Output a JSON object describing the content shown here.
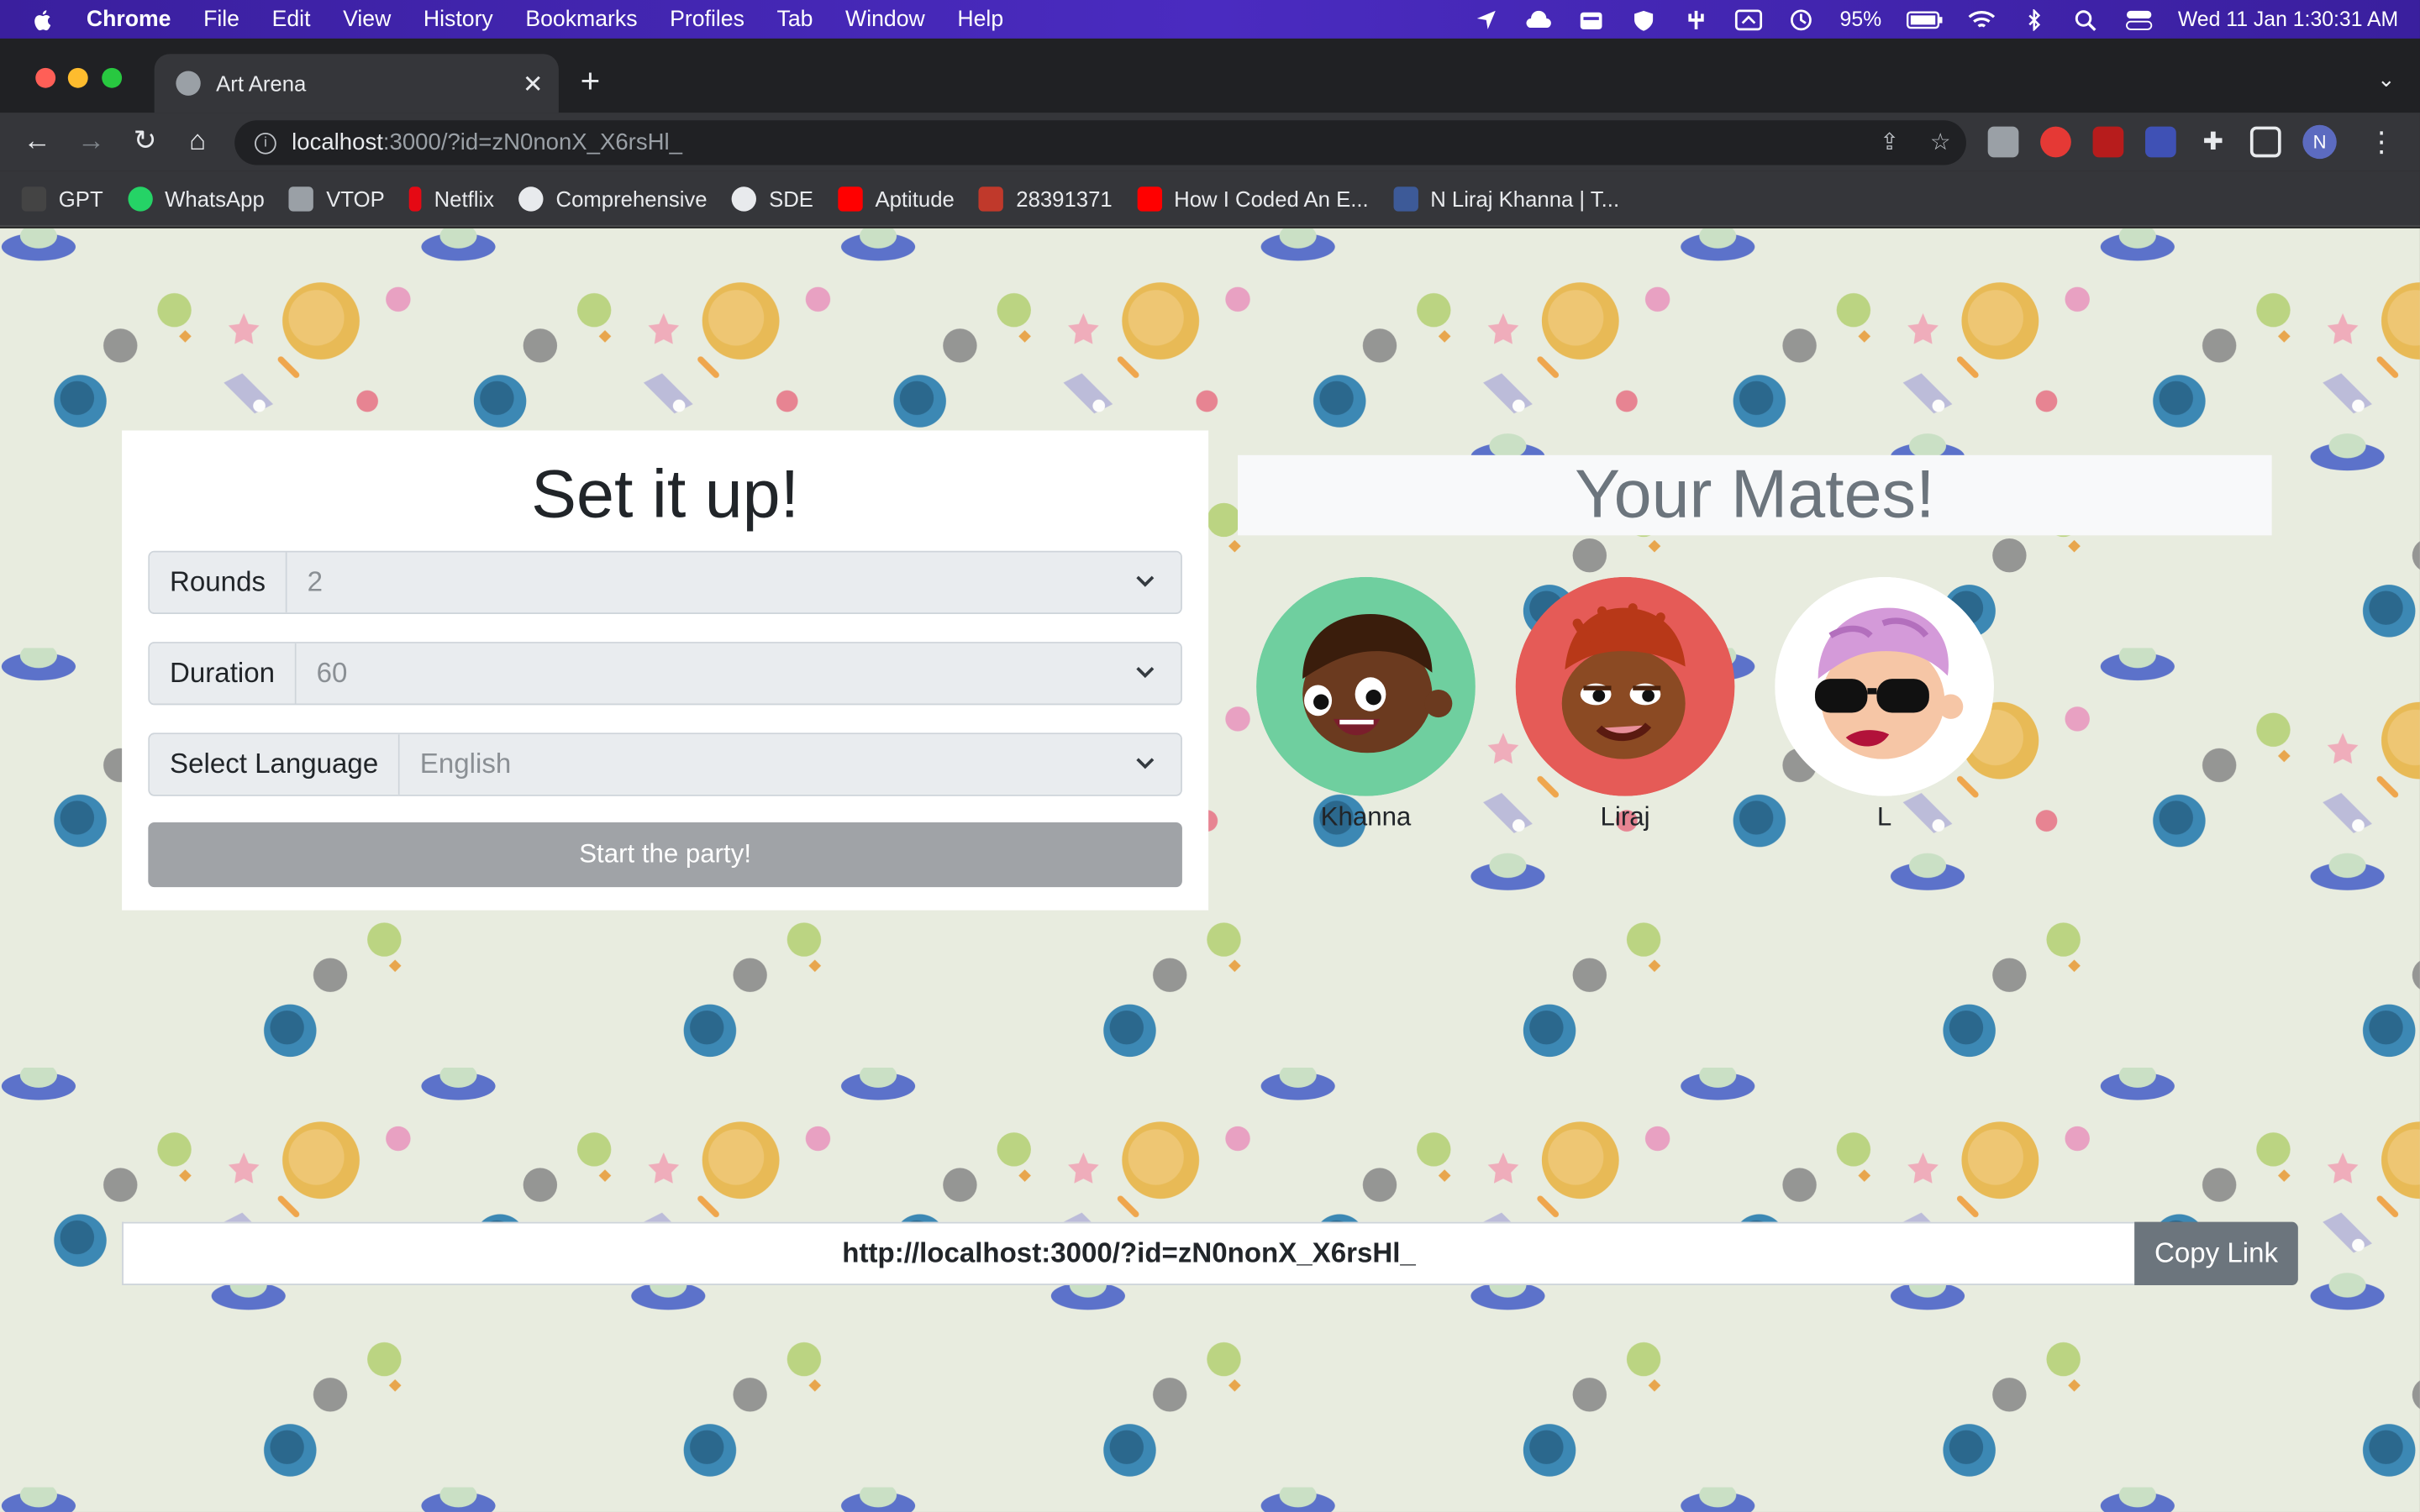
{
  "menubar": {
    "app": "Chrome",
    "items": [
      "File",
      "Edit",
      "View",
      "History",
      "Bookmarks",
      "Profiles",
      "Tab",
      "Window",
      "Help"
    ],
    "battery": "95%",
    "datetime": "Wed 11 Jan  1:30:31 AM"
  },
  "browser": {
    "tab_title": "Art Arena",
    "url_host": "localhost",
    "url_path": ":3000/?id=zN0nonX_X6rsHl_",
    "profile_initial": "N",
    "bookmarks": [
      {
        "label": "GPT",
        "color": "#444444"
      },
      {
        "label": "WhatsApp",
        "color": "#25d366"
      },
      {
        "label": "VTOP",
        "color": "#9aa0a6"
      },
      {
        "label": "Netflix",
        "color": "#e50914"
      },
      {
        "label": "Comprehensive",
        "color": "#e8eaed"
      },
      {
        "label": "SDE",
        "color": "#e8eaed"
      },
      {
        "label": "Aptitude",
        "color": "#ff0000"
      },
      {
        "label": "28391371",
        "color": "#c0392b"
      },
      {
        "label": "How I Coded An E...",
        "color": "#ff0000"
      },
      {
        "label": "N Liraj Khanna | T...",
        "color": "#3d5a98"
      }
    ]
  },
  "setup": {
    "title": "Set it up!",
    "rounds_label": "Rounds",
    "rounds_value": "2",
    "duration_label": "Duration",
    "duration_value": "60",
    "language_label": "Select Language",
    "language_value": "English",
    "start_button": "Start the party!"
  },
  "mates": {
    "title": "Your Mates!",
    "players": [
      {
        "name": "Khanna",
        "bg": "#6fcf9f"
      },
      {
        "name": "Liraj",
        "bg": "#e55b57"
      },
      {
        "name": "L",
        "bg": "#ffffff"
      }
    ]
  },
  "invite": {
    "link": "http://localhost:3000/?id=zN0nonX_X6rsHl_",
    "copy_button": "Copy Link"
  }
}
